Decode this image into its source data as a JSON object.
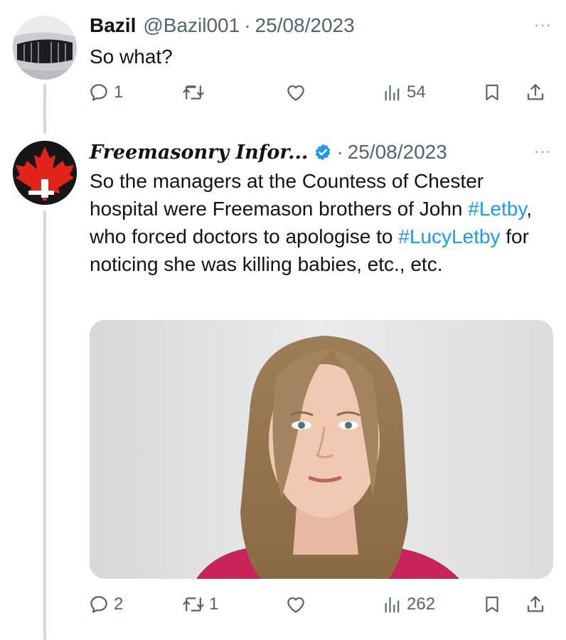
{
  "tweets": [
    {
      "display_name": "Bazil",
      "handle": "@Bazil001",
      "separator": "·",
      "date": "25/08/2023",
      "more": "···",
      "text": "So what?",
      "replies": "1",
      "retweets": "",
      "views": "54"
    },
    {
      "display_name": "Freemasonry Infor...",
      "verified": true,
      "separator": "·",
      "date": "25/08/2023",
      "more": "···",
      "text_parts": {
        "a": "So the managers at the Countess of Chester hospital were Freemason brothers of John ",
        "hashtag1": "#Letby",
        "b": ", who forced doctors to apologise to ",
        "hashtag2": "#LucyLetby",
        "c": " for noticing she was killing babies, etc., etc."
      },
      "media": {
        "type": "photo"
      },
      "replies": "2",
      "retweets": "1",
      "views": "262"
    }
  ],
  "colors": {
    "text": "#0f1419",
    "secondary": "#536471",
    "link": "#1d9bf0",
    "thread_line": "#cfd9de",
    "verified": "#1d9bf0"
  },
  "icons": [
    "reply-icon",
    "retweet-icon",
    "like-icon",
    "views-icon",
    "bookmark-icon",
    "share-icon",
    "more-icon",
    "verified-badge-icon"
  ]
}
